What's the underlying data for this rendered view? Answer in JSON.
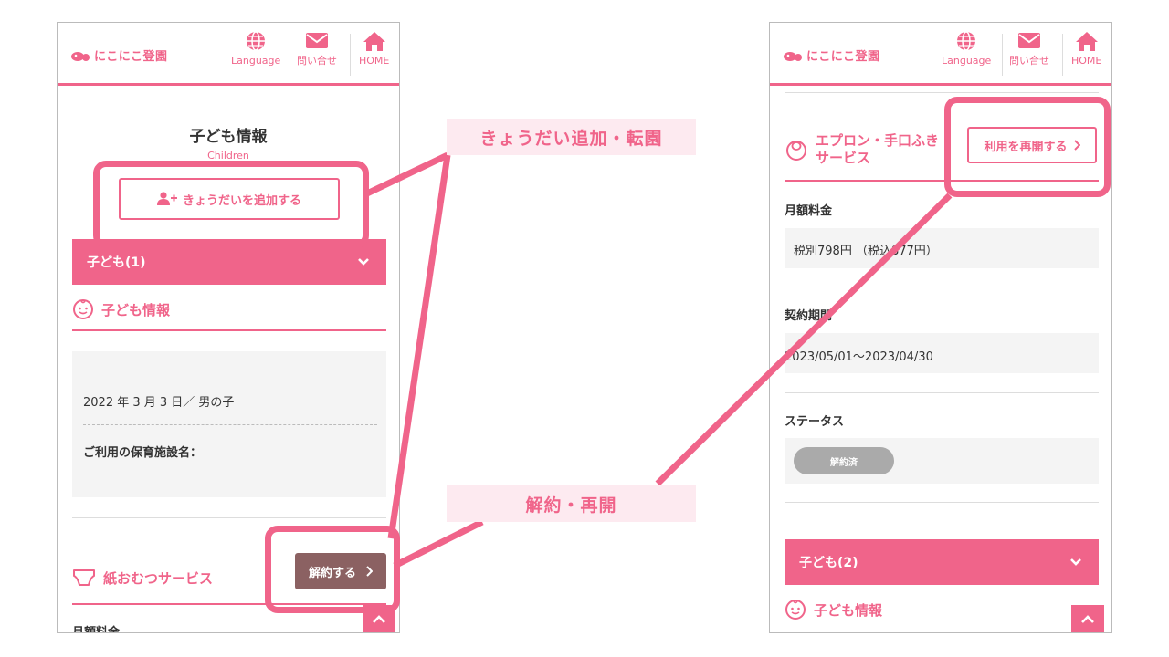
{
  "brand": {
    "logo_text": "にこにこ登園",
    "accent": "#f0648a"
  },
  "header_nav": {
    "language": "Language",
    "contact": "問い合せ",
    "home": "HOME"
  },
  "left": {
    "page_title": "子ども情報",
    "page_subtitle": "Children",
    "add_sibling_button": "きょうだいを追加する",
    "accordion_label": "子ども(1)",
    "child_info_heading": "子ども情報",
    "birth_gender": "2022 年 3 月 3 日／ 男の子",
    "facility_label": "ご利用の保育施設名：",
    "diaper_service_heading": "紙おむつサービス",
    "cancel_button": "解約する",
    "monthly_fee_label": "月額料金"
  },
  "right": {
    "apron_service_heading_line1": "エプロン・手口ふき",
    "apron_service_heading_line2": "サービス",
    "resume_button": "利用を再開する",
    "monthly_fee_label": "月額料金",
    "monthly_fee_value": "税別798円 （税込877円）",
    "contract_period_label": "契約期間",
    "contract_period_value": "2023/05/01〜2023/04/30",
    "status_label": "ステータス",
    "status_value": "解約済",
    "accordion_label": "子ども(2)",
    "child_info_heading": "子ども情報"
  },
  "callouts": {
    "top": "きょうだい追加・転園",
    "bottom": "解約・再開"
  }
}
